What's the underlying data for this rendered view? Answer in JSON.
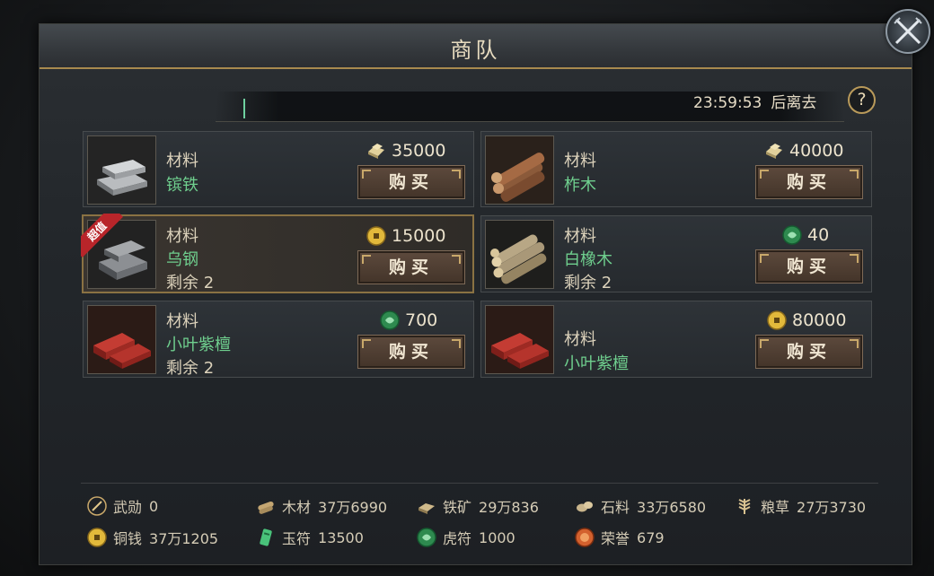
{
  "title": "商队",
  "timer": {
    "time": "23:59:53",
    "suffix": "后离去"
  },
  "help_label": "?",
  "cards": [
    {
      "category": "材料",
      "name": "镔铁",
      "remaining": "",
      "price": "35000",
      "currency": "silver-ingot-icon",
      "buy": "购买",
      "badge": ""
    },
    {
      "category": "材料",
      "name": "柞木",
      "remaining": "",
      "price": "40000",
      "currency": "silver-ingot-icon",
      "buy": "购买",
      "badge": ""
    },
    {
      "category": "材料",
      "name": "乌钢",
      "remaining": "剩余 2",
      "price": "15000",
      "currency": "copper-coin-icon",
      "buy": "购买",
      "badge": "超值"
    },
    {
      "category": "材料",
      "name": "白橡木",
      "remaining": "剩余 2",
      "price": "40",
      "currency": "jade-token-icon",
      "buy": "购买",
      "badge": ""
    },
    {
      "category": "材料",
      "name": "小叶紫檀",
      "remaining": "剩余 2",
      "price": "700",
      "currency": "jade-token-icon",
      "buy": "购买",
      "badge": ""
    },
    {
      "category": "材料",
      "name": "小叶紫檀",
      "remaining": "",
      "price": "80000",
      "currency": "copper-coin-icon",
      "buy": "购买",
      "badge": ""
    }
  ],
  "resources": [
    {
      "label": "武勋",
      "value": "0",
      "icon": "merit-icon"
    },
    {
      "label": "木材",
      "value": "37万6990",
      "icon": "wood-icon"
    },
    {
      "label": "铁矿",
      "value": "29万836",
      "icon": "iron-ore-icon"
    },
    {
      "label": "石料",
      "value": "33万6580",
      "icon": "stone-icon"
    },
    {
      "label": "粮草",
      "value": "27万3730",
      "icon": "grain-icon"
    },
    {
      "label": "铜钱",
      "value": "37万1205",
      "icon": "copper-coin-icon"
    },
    {
      "label": "玉符",
      "value": "13500",
      "icon": "jade-tally-icon"
    },
    {
      "label": "虎符",
      "value": "1000",
      "icon": "tiger-tally-icon"
    },
    {
      "label": "荣誉",
      "value": "679",
      "icon": "honor-icon"
    }
  ],
  "colors": {
    "accent_gold": "#a88a4f",
    "item_name_green": "#6fcf8e",
    "badge_red": "#b8252a"
  }
}
